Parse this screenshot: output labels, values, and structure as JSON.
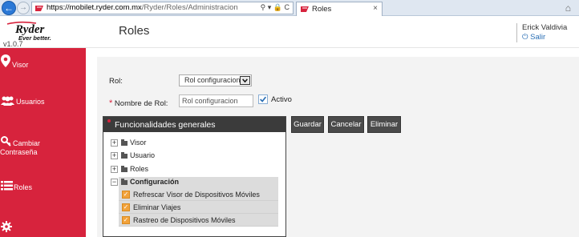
{
  "browser": {
    "url_host": "https://mobilet.ryder.com.mx",
    "url_path": "/Ryder/Roles/Administracion",
    "tab_title": "Roles"
  },
  "header": {
    "logo_text": "Ryder",
    "logo_tagline": "Ever better.",
    "version": "v1.0.7",
    "page_title": "Roles",
    "user_name": "Erick Valdivia",
    "logout_label": "Salir"
  },
  "sidebar": {
    "items": [
      {
        "label": "Visor",
        "icon": "map-pin-icon"
      },
      {
        "label": "Usuarios",
        "icon": "users-icon"
      },
      {
        "label": "Cambiar Contraseña",
        "icon": "key-icon"
      },
      {
        "label": "Roles",
        "icon": "list-icon"
      },
      {
        "label": "",
        "icon": "gear-icon"
      }
    ]
  },
  "form": {
    "rol_label": "Rol:",
    "rol_selected": "Rol configuracion",
    "nombre_label": "Nombre de Rol:",
    "nombre_value": "Rol configuracion",
    "activo_label": "Activo",
    "activo_checked": true
  },
  "panel": {
    "title": "Funcionalidades generales",
    "tree": [
      {
        "label": "Visor",
        "expanded": false
      },
      {
        "label": "Usuario",
        "expanded": false
      },
      {
        "label": "Roles",
        "expanded": false
      },
      {
        "label": "Configuración",
        "expanded": true
      }
    ],
    "children": [
      "Refrescar Visor de Dispositivos Móviles",
      "Eliminar Viajes",
      "Rastreo de Dispositivos Móviles"
    ]
  },
  "buttons": {
    "guardar": "Guardar",
    "cancelar": "Cancelar",
    "eliminar": "Eliminar"
  },
  "colors": {
    "accent": "#d7233d",
    "panel_header": "#3b3b3b",
    "checkbox_orange": "#f2a23a",
    "link_blue": "#2a6fb5"
  }
}
